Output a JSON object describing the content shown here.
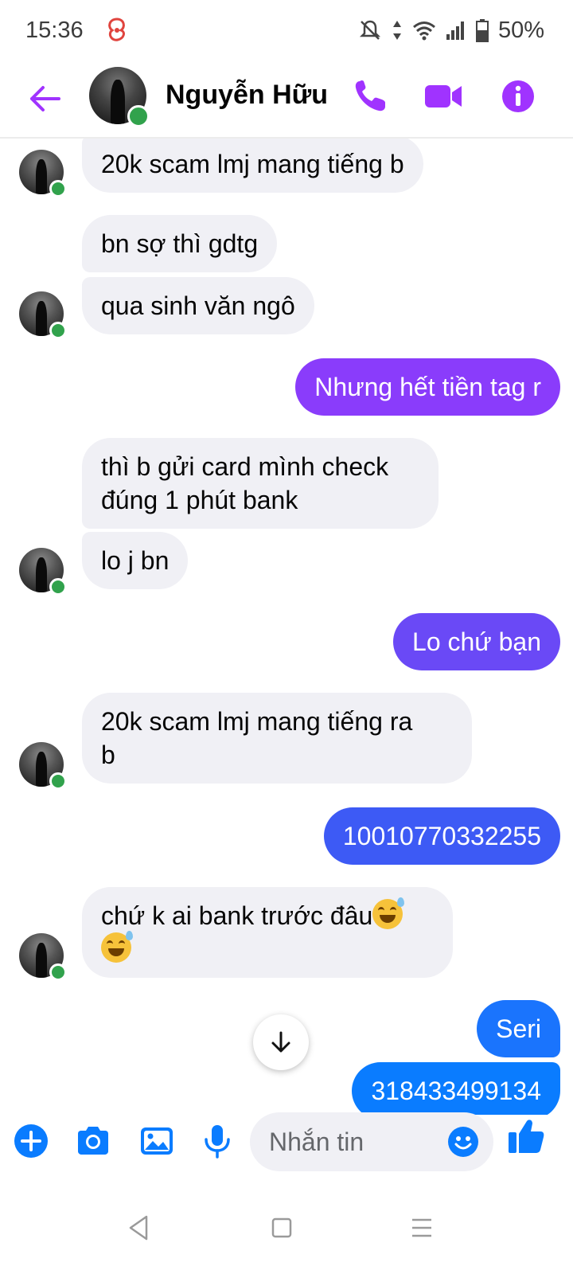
{
  "status_bar": {
    "time": "15:36",
    "battery": "50%"
  },
  "header": {
    "contact_name": "Nguyễn Hữu"
  },
  "messages": [
    {
      "text": "20k scam lmj mang tiếng b",
      "dir": "in"
    },
    {
      "text": "bn sợ thì gdtg",
      "dir": "in"
    },
    {
      "text": "qua sinh văn ngô",
      "dir": "in"
    },
    {
      "text": "Nhưng hết tiền tag r",
      "dir": "out"
    },
    {
      "line1": "thì b gửi card mình check",
      "line2": "đúng 1 phút bank",
      "dir": "in"
    },
    {
      "text": "lo j bn",
      "dir": "in"
    },
    {
      "text": "Lo chứ bạn",
      "dir": "out"
    },
    {
      "line1": "20k scam lmj mang tiếng ra",
      "line2": "b",
      "dir": "in"
    },
    {
      "text": "10010770332255",
      "dir": "out"
    },
    {
      "text": "chứ k ai bank trước đâu",
      "dir": "in",
      "emoji": "grinning-sweat-emoji"
    },
    {
      "text": "Seri",
      "dir": "out"
    },
    {
      "text": "318433499134",
      "dir": "out"
    }
  ],
  "composer": {
    "placeholder": "Nhắn tin"
  },
  "colors": {
    "accent": "#a033ff",
    "gradient_top": "#a033ff",
    "gradient_mid": "#5b4cf2",
    "gradient_bottom": "#0a7cff",
    "incoming_bg": "#f0f0f5",
    "online": "#31a24c"
  }
}
